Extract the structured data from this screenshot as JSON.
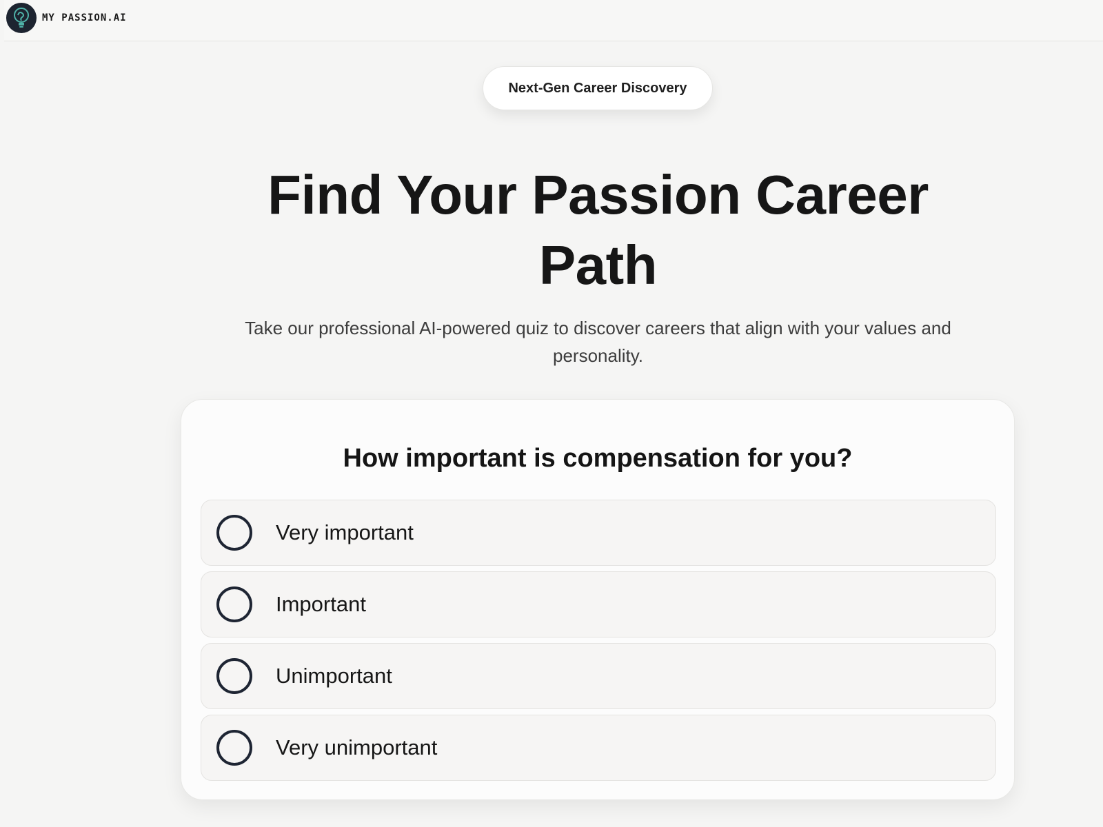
{
  "header": {
    "brand_name": "MY PASSION.AI",
    "logo_icon": "lightbulb-brain-icon"
  },
  "hero": {
    "badge": "Next-Gen Career Discovery",
    "title": "Find Your Passion Career Path",
    "subtitle": "Take our professional AI-powered quiz to discover careers that align with your values and personality."
  },
  "quiz": {
    "question": "How important is compensation for you?",
    "options": [
      {
        "label": "Very important",
        "selected": false
      },
      {
        "label": "Important",
        "selected": false
      },
      {
        "label": "Unimportant",
        "selected": false
      },
      {
        "label": "Very unimportant",
        "selected": false
      }
    ]
  },
  "colors": {
    "background": "#f5f5f4",
    "card": "#fcfcfc",
    "radio_border": "#1e2533",
    "logo_bg": "#1d2430",
    "logo_accent": "#4fb3a9"
  }
}
